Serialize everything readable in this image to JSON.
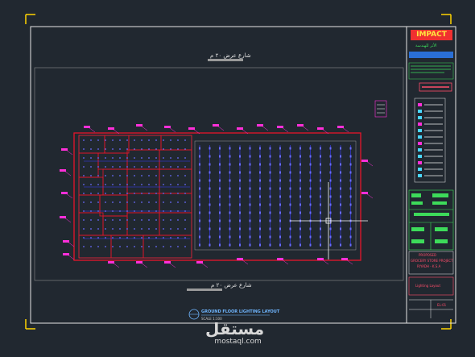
{
  "drawing": {
    "street_top": "شارع عرض ٢٠ م",
    "street_bottom": "شارع عرض ٢٠ م",
    "plan_title": "GROUND FLOOR LIGHTING LAYOUT",
    "scale_text": "SCALE 1:100"
  },
  "title_block": {
    "logo_text": "IMPACT",
    "company_ar": "الأثر للهندسة",
    "project_lines": [
      "PROPOSED",
      "GROCERY STORE PROJECT",
      "RIYADH - K.S.A"
    ],
    "drawing_title": "Lighting Layout",
    "drawing_no": "EL-01"
  },
  "watermark": {
    "arabic": "مستقل",
    "latin": "mostaql.com"
  },
  "colors": {
    "background": "#212830",
    "frame": "#e6e6e6",
    "corner_marks": "#ffd400",
    "wall_red": "#e8142a",
    "fixture_blue": "#3a3cff",
    "tag_magenta": "#ff2fd9",
    "green_block": "#2fd84a",
    "crosshair": "#ffffff"
  }
}
